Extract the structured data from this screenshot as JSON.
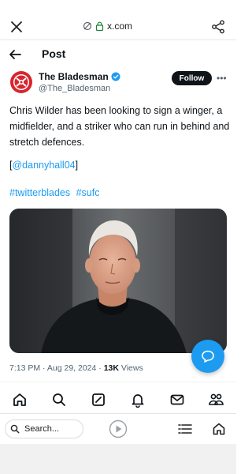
{
  "browser": {
    "url": "x.com",
    "search_placeholder": "Search..."
  },
  "header": {
    "title": "Post"
  },
  "author": {
    "name": "The Bladesman",
    "handle": "@The_Bladesman",
    "follow_label": "Follow"
  },
  "tweet": {
    "text": "Chris Wilder has been looking to sign a winger, a midfielder, and a striker who can run in behind and stretch defences.",
    "mention_prefix": "[",
    "mention": "@dannyhall04",
    "mention_suffix": "]",
    "hashtags": [
      "#twitterblades",
      "#sufc"
    ]
  },
  "meta": {
    "time": "7:13 PM",
    "separator": "·",
    "date": "Aug 29, 2024",
    "views_count": "13K",
    "views_label": "Views"
  },
  "colors": {
    "accent": "#1d9bf0",
    "text": "#0f1419",
    "muted": "#536471",
    "follow_bg": "#0f1419",
    "verified": "#1d9bf0",
    "club_red": "#d7262e"
  },
  "nav_icons": [
    "home-icon",
    "search-icon",
    "grok-icon",
    "notifications-icon",
    "messages-icon",
    "communities-icon"
  ]
}
